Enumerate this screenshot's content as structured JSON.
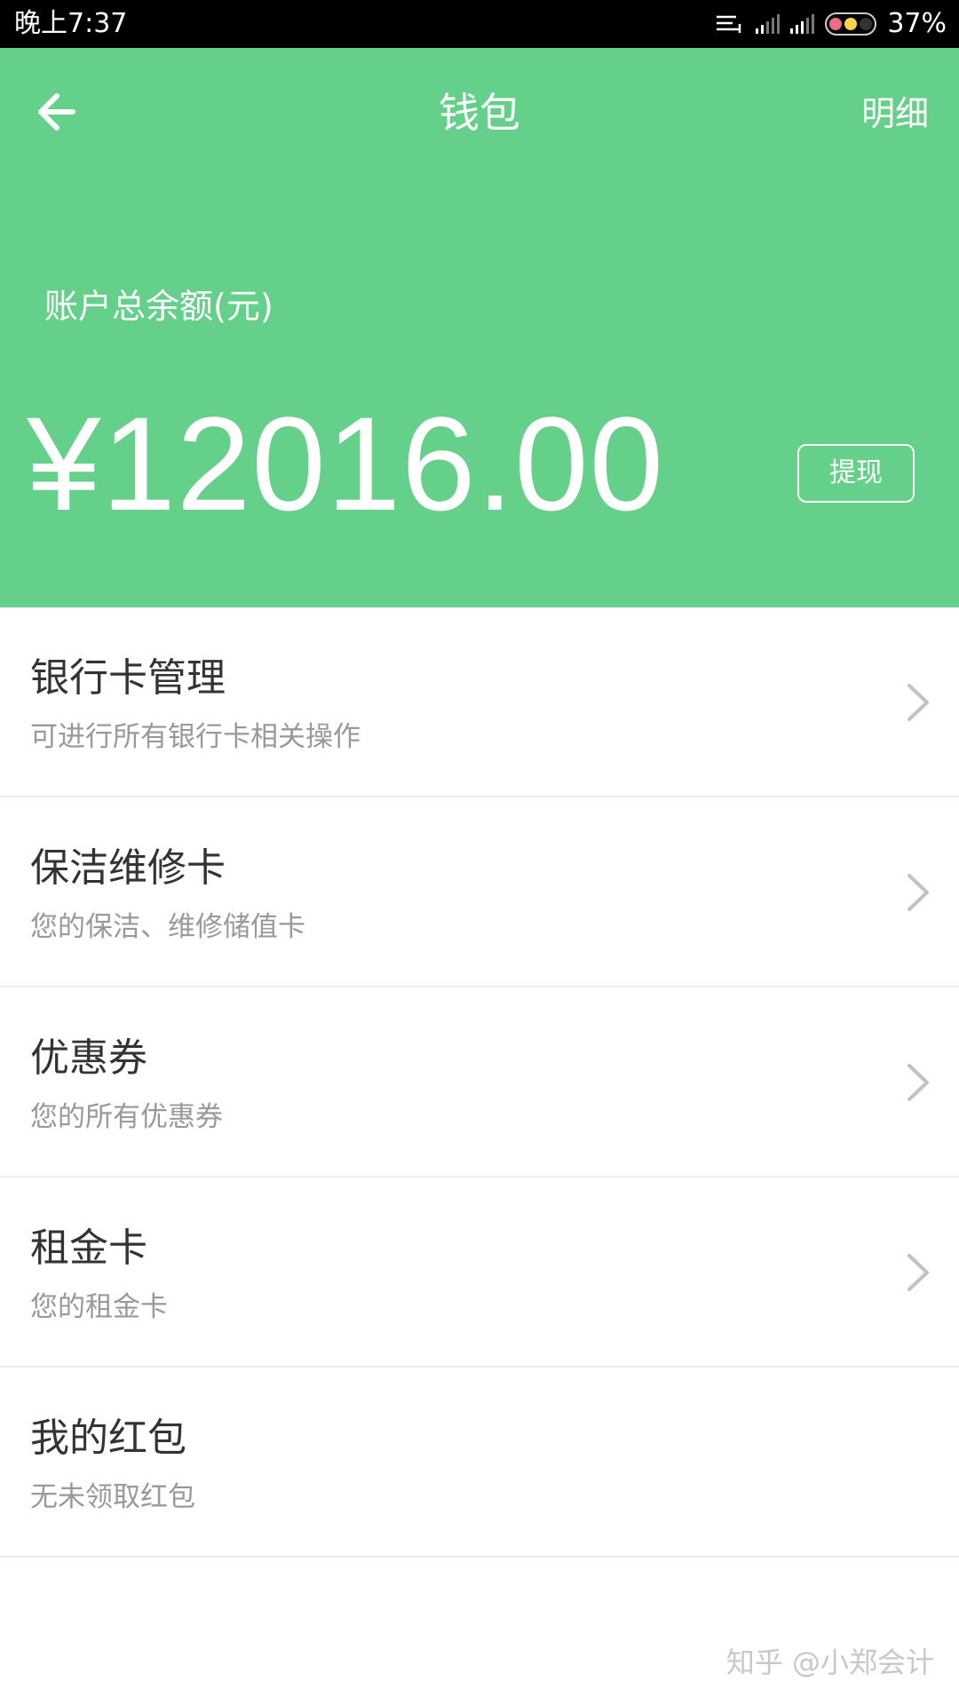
{
  "status_bar": {
    "time": "晚上7:37",
    "battery_percent": "37%",
    "icons": [
      "notification-icon",
      "signal-icon",
      "signal-icon",
      "battery-icon"
    ]
  },
  "header": {
    "title": "钱包",
    "back_icon": "arrow-left-icon",
    "detail_label": "明细",
    "balance_label": "账户总余额(元)",
    "balance_value": "¥12016.00",
    "withdraw_label": "提现",
    "background_color": "#65d08a"
  },
  "menu": {
    "items": [
      {
        "title": "银行卡管理",
        "subtitle": "可进行所有银行卡相关操作"
      },
      {
        "title": "保洁维修卡",
        "subtitle": "您的保洁、维修储值卡"
      },
      {
        "title": "优惠券",
        "subtitle": "您的所有优惠券"
      },
      {
        "title": "租金卡",
        "subtitle": "您的租金卡"
      },
      {
        "title": "我的红包",
        "subtitle": "无未领取红包"
      }
    ],
    "chevron_icon": "chevron-right-icon"
  },
  "watermark": "知乎 @小郑会计"
}
